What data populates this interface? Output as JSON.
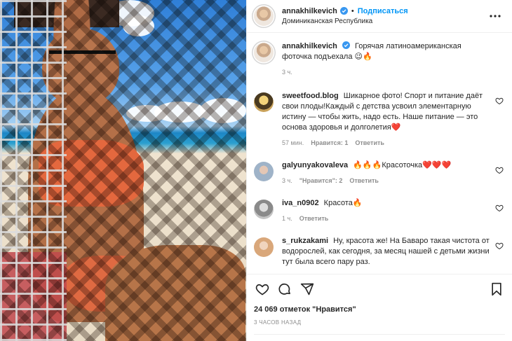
{
  "post": {
    "author": "annakhilkevich",
    "follow_label": "Подписаться",
    "separator": "•",
    "location": "Доминиканская Республика",
    "caption": "Горячая латиноамериканская фоточка подъехала",
    "caption_emoji": "😉🔥",
    "caption_time": "3 ч."
  },
  "comments": [
    {
      "user": "sweetfood.blog",
      "text": "Шикарное фото! Спорт и питание даёт свои плоды!Каждый с детства усвоил элементарную истину — чтобы жить, надо есть. Наше питание — это основа здоровья и долголетия",
      "text_emoji": "❤️",
      "time": "57 мин.",
      "likes": "Нравится: 1",
      "reply": "Ответить",
      "avatar_color": "#c9a25a"
    },
    {
      "user": "galyunyakovaleva",
      "text": "Красоточка",
      "pre_emoji": "🔥🔥🔥",
      "text_emoji": "❤️❤️❤️",
      "time": "3 ч.",
      "likes": "\"Нравится\": 2",
      "reply": "Ответить",
      "avatar_color": "#9fb3c8"
    },
    {
      "user": "iva_n0902",
      "text": "Красота",
      "text_emoji": "🔥",
      "time": "1 ч.",
      "reply": "Ответить",
      "avatar_color": "#a8a8a8"
    },
    {
      "user": "s_rukzakami",
      "text": "Ну, красота же! На Баваро такая чистота от водорослей, как сегодня, за месяц нашей с детьми жизни тут была всего пару раз.",
      "avatar_color": "#d9a77a"
    }
  ],
  "actions": {
    "likes_count": "24 069 отметок \"Нравится\"",
    "posted_ago": "3 ЧАСОВ НАЗАД"
  },
  "icons": [
    "more-icon",
    "verified-icon",
    "heart-icon",
    "comment-icon",
    "share-icon",
    "bookmark-icon"
  ],
  "colors": {
    "accent": "#0095f6",
    "verified": "#3897f0",
    "meta_gray": "#8e8e8e",
    "heart_red": "#ed4956"
  }
}
